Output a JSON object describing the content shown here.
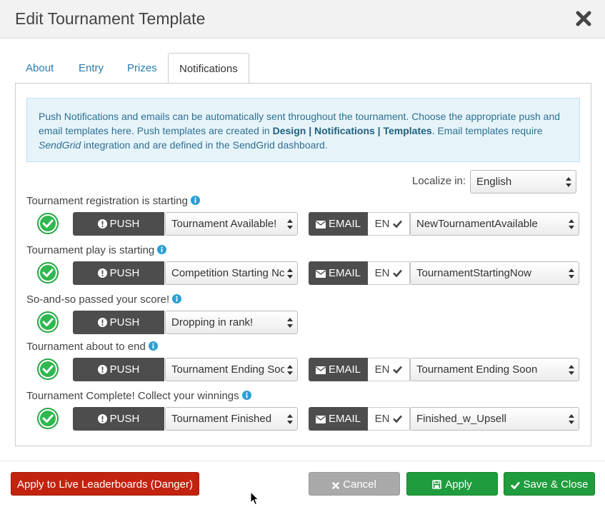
{
  "dialog": {
    "title": "Edit Tournament Template"
  },
  "tabs": [
    {
      "label": "About",
      "active": false
    },
    {
      "label": "Entry",
      "active": false
    },
    {
      "label": "Prizes",
      "active": false
    },
    {
      "label": "Notifications",
      "active": true
    }
  ],
  "info": {
    "part1": "Push Notifications and emails can be automatically sent throughout the tournament. Choose the appropriate push and email templates here. Push templates are created in ",
    "bold": "Design | Notifications | Templates",
    "part2": ". Email templates require ",
    "italic": "SendGrid",
    "part3": " integration and are defined in the SendGrid dashboard."
  },
  "localize": {
    "label": "Localize in:",
    "value": "English"
  },
  "labels": {
    "push": "PUSH",
    "email": "EMAIL",
    "lang": "EN"
  },
  "rows": [
    {
      "label": "Tournament registration is starting",
      "enabled": true,
      "push": "Tournament Available!",
      "email": "NewTournamentAvailable"
    },
    {
      "label": "Tournament play is starting",
      "enabled": true,
      "push": "Competition Starting Nc",
      "email": "TournamentStartingNow"
    },
    {
      "label": "So-and-so passed your score!",
      "enabled": true,
      "push": "Dropping in rank!",
      "email": null
    },
    {
      "label": "Tournament about to end",
      "enabled": true,
      "push": "Tournament Ending Soc",
      "email": "Tournament Ending Soon"
    },
    {
      "label": "Tournament Complete! Collect your winnings",
      "enabled": true,
      "push": "Tournament Finished",
      "email": "Finished_w_Upsell"
    }
  ],
  "footer": {
    "danger": "Apply to Live Leaderboards (Danger)",
    "cancel": "Cancel",
    "apply": "Apply",
    "save": "Save & Close"
  },
  "colors": {
    "accent_green": "#1f9c3d",
    "danger_red": "#c2230e",
    "dark_button": "#4d4d4d",
    "info_blue": "#2a9fd6"
  }
}
